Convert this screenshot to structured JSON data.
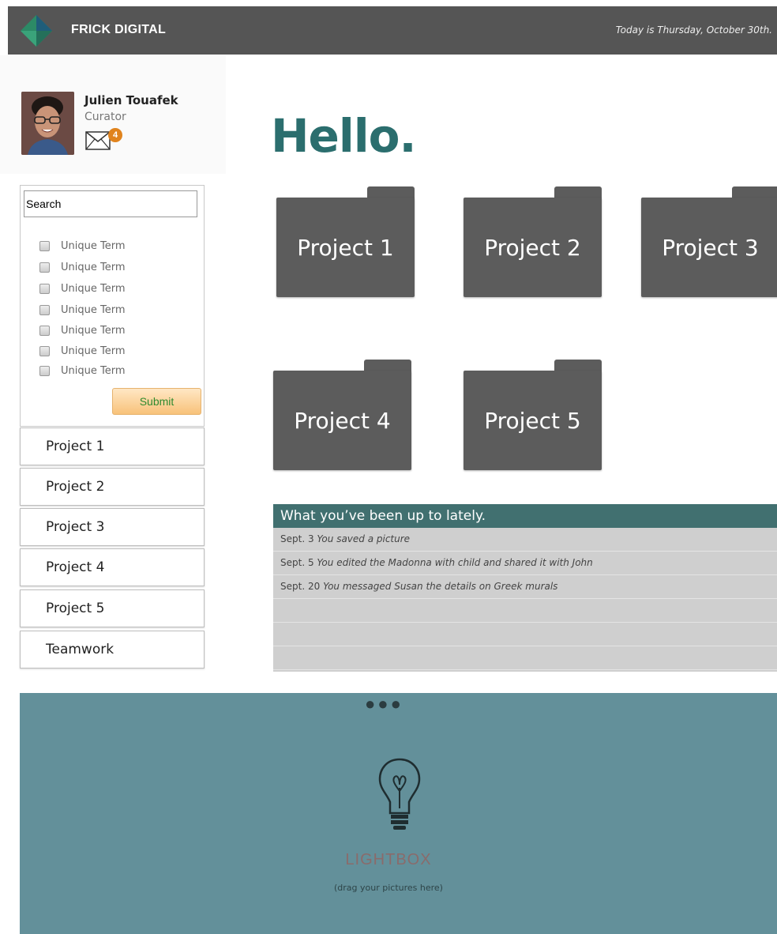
{
  "header": {
    "brand": "FRICK DIGITAL",
    "date_text": "Today is Thursday, October 30th.",
    "logo_icon": "diamond-logo-icon"
  },
  "profile": {
    "name": "Julien Touafek",
    "role": "Curator",
    "mail_icon": "envelope-icon",
    "unread_count": "4"
  },
  "greeting": "Hello.",
  "search": {
    "value": "Search",
    "terms": [
      "Unique Term",
      "Unique Term",
      "Unique Term",
      "Unique Term",
      "Unique Term",
      "Unique Term",
      "Unique Term"
    ],
    "submit_label": "Submit"
  },
  "sidebar": {
    "items": [
      "Project 1",
      "Project 2",
      "Project 3",
      "Project 4",
      "Project 5",
      "Teamwork"
    ]
  },
  "projects": [
    "Project 1",
    "Project 2",
    "Project 3",
    "Project 4",
    "Project 5"
  ],
  "activity": {
    "title": "What you’ve been up to lately.",
    "items": [
      {
        "date": "Sept. 3",
        "text": "You saved a picture"
      },
      {
        "date": "Sept. 5",
        "text": "You edited the Madonna with child and shared it with John"
      },
      {
        "date": "Sept. 20",
        "text": "You messaged Susan the details on Greek murals"
      }
    ]
  },
  "lightbox": {
    "title": "LIGHTBOX",
    "subtitle": "(drag your pictures here)",
    "icon": "lightbulb-icon",
    "menu_icon": "ellipsis-icon"
  },
  "colors": {
    "header_bg": "#555555",
    "accent_teal": "#2b6e6e",
    "activity_header": "#417070",
    "lightbox_bg": "#63909a",
    "folder": "#5c5c5c",
    "badge": "#e0831d"
  }
}
